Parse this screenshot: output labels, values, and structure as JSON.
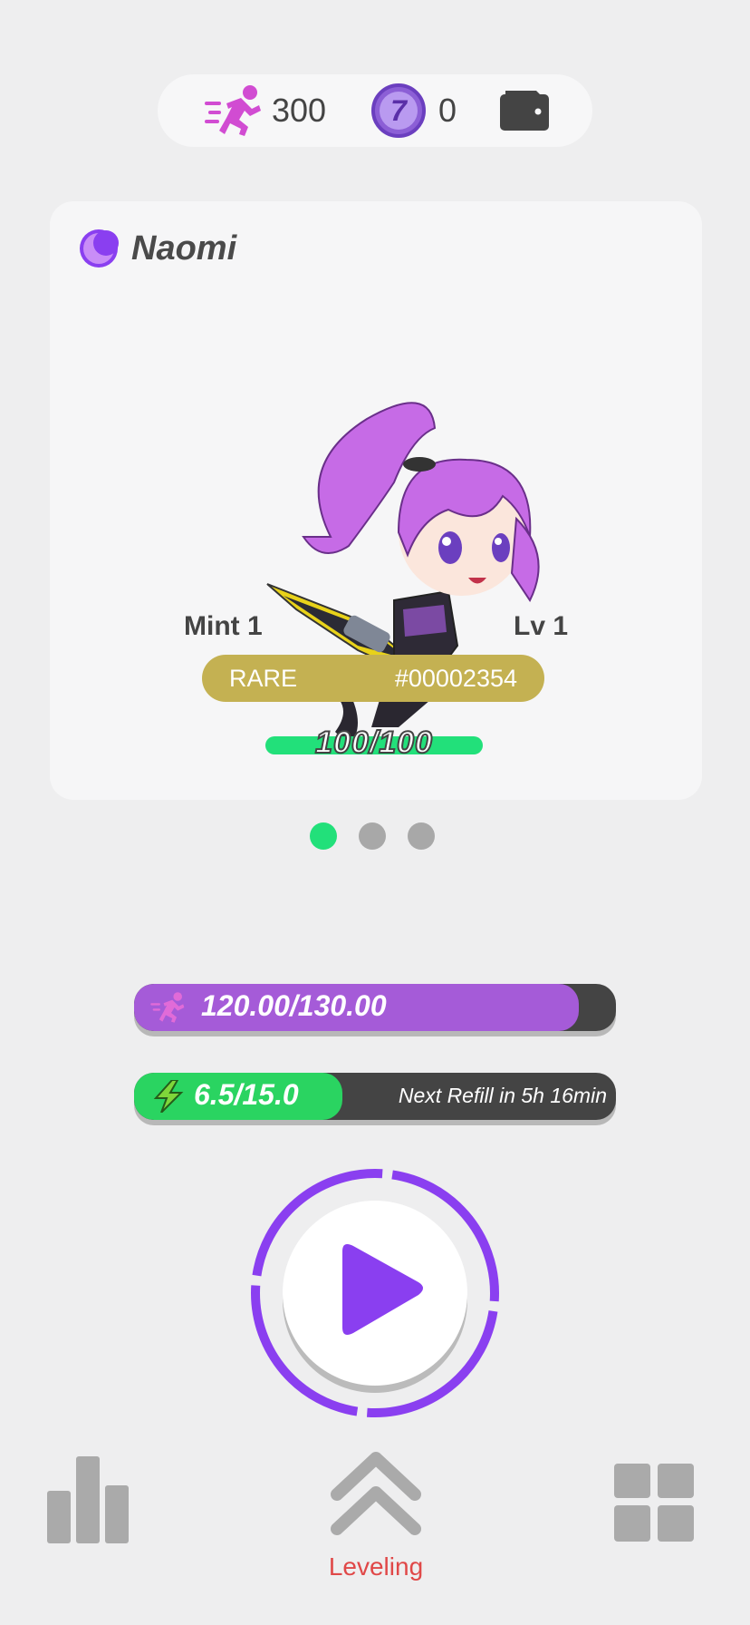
{
  "top_bar": {
    "steps_value": "300",
    "token_symbol": "7",
    "token_value": "0",
    "icons": [
      "running-man-icon",
      "seven-token-icon",
      "wallet-icon"
    ]
  },
  "card": {
    "name": "Naomi",
    "class_icon": "moon-icon",
    "mint": "Mint 1",
    "level": "Lv 1",
    "rarity": "RARE",
    "id": "#00002354",
    "hp_text": "100/100",
    "hp_fraction": 1.0
  },
  "pager": {
    "count": 3,
    "active": 0
  },
  "stats": {
    "run_text": "120.00/130.00",
    "run_fraction": 0.923,
    "energy_text": "6.5/15.0",
    "energy_fraction": 0.433,
    "refill_text": "Next Refill in 5h 16min"
  },
  "nav": {
    "leveling_label": "Leveling",
    "active": "leveling"
  },
  "colors": {
    "accent_purple": "#8a3ff0",
    "green": "#22e07a",
    "rare_gold": "#c4b152",
    "nav_active_red": "#e04848"
  }
}
